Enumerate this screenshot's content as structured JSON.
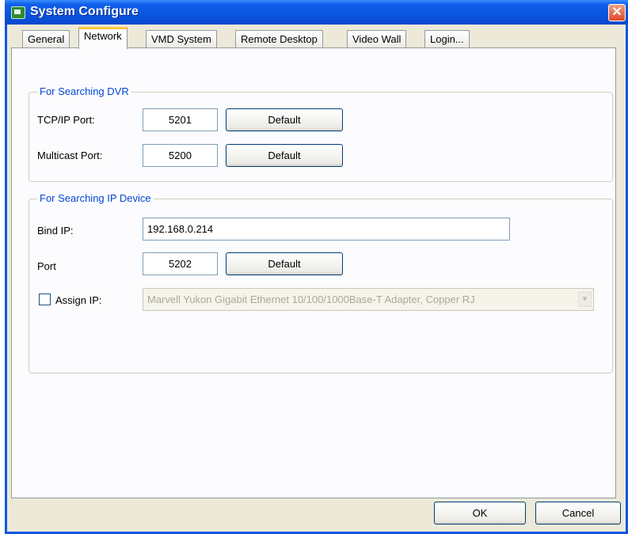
{
  "window": {
    "title": "System Configure",
    "close_symbol": "✕"
  },
  "tabs": [
    {
      "label": "General"
    },
    {
      "label": "Network"
    },
    {
      "label": "VMD System"
    },
    {
      "label": "Remote Desktop"
    },
    {
      "label": "Video Wall"
    },
    {
      "label": "Login..."
    }
  ],
  "active_tab": "Network",
  "dvr_group": {
    "title": "For Searching DVR",
    "tcp_label": "TCP/IP Port:",
    "tcp_value": "5201",
    "multicast_label": "Multicast Port:",
    "multicast_value": "5200",
    "default_label": "Default"
  },
  "ip_group": {
    "title": "For Searching IP Device",
    "bind_label": "Bind IP:",
    "bind_value": "192.168.0.214",
    "port_label": "Port",
    "port_value": "5202",
    "default_label": "Default",
    "assign_label": "Assign IP:",
    "assign_checked": false,
    "adapter_value": "Marvell Yukon Gigabit Ethernet 10/100/1000Base-T Adapter, Copper RJ"
  },
  "footer": {
    "ok_label": "OK",
    "cancel_label": "Cancel"
  }
}
